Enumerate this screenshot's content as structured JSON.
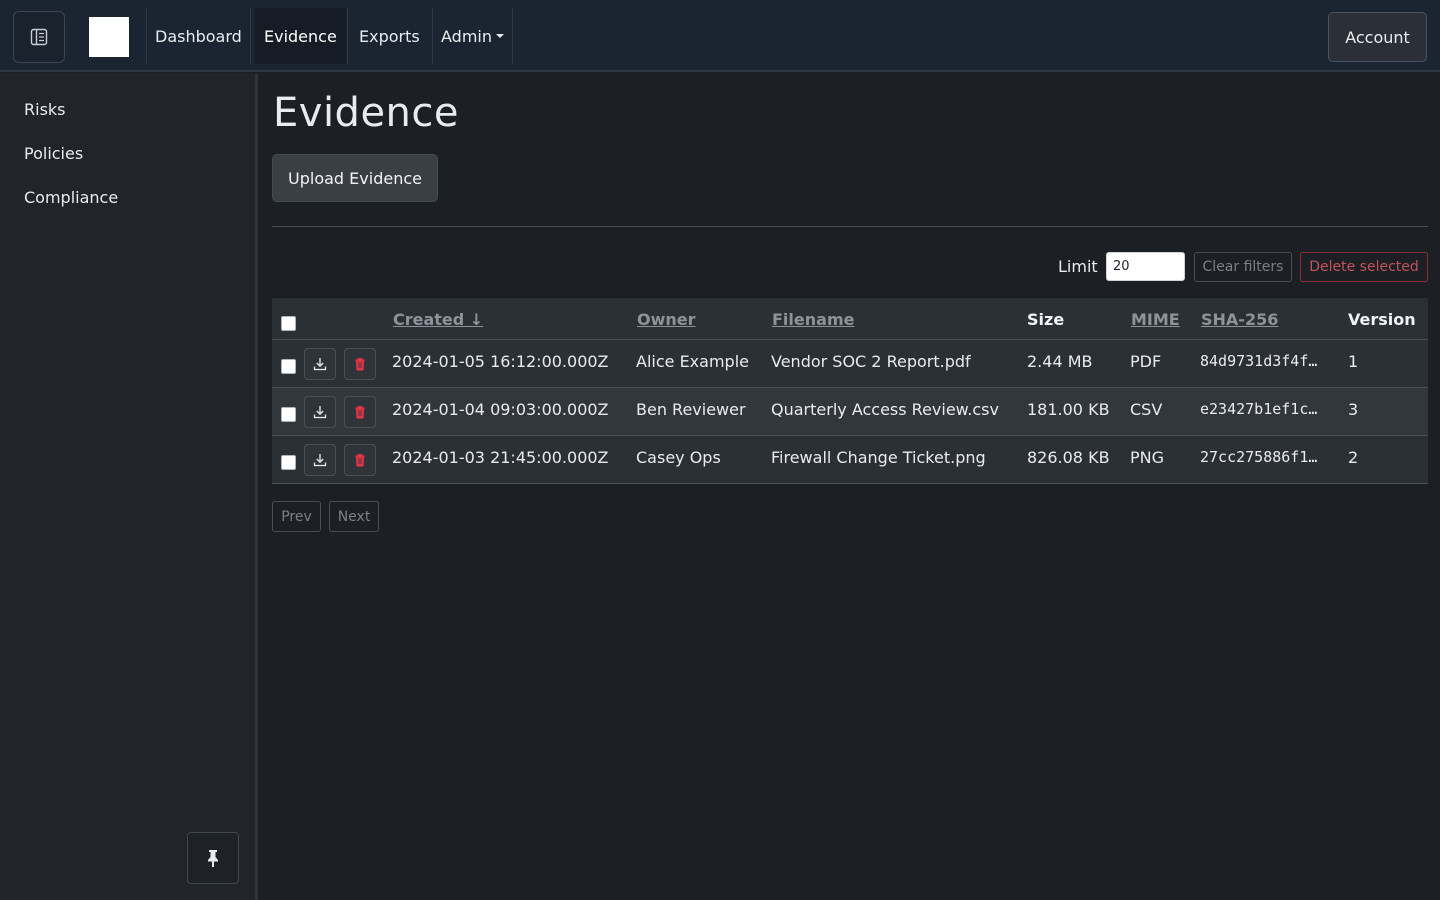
{
  "topbar": {
    "nav": [
      {
        "label": "Dashboard"
      },
      {
        "label": "Evidence"
      },
      {
        "label": "Exports"
      },
      {
        "label": "Admin"
      }
    ],
    "account_label": "Account"
  },
  "sidebar": {
    "items": [
      {
        "label": "Risks"
      },
      {
        "label": "Policies"
      },
      {
        "label": "Compliance"
      }
    ]
  },
  "main": {
    "title": "Evidence",
    "upload_label": "Upload Evidence",
    "limit_label": "Limit",
    "limit_value": "20",
    "clear_filters_label": "Clear filters",
    "delete_selected_label": "Delete selected",
    "prev_label": "Prev",
    "next_label": "Next"
  },
  "table": {
    "columns": [
      "Created ↓",
      "Owner",
      "Filename",
      "Size",
      "MIME",
      "SHA-256",
      "Version"
    ],
    "rows": [
      {
        "created": "2024-01-05 16:12:00.000Z",
        "owner": "Alice Example",
        "filename": "Vendor SOC 2 Report.pdf",
        "size": "2.44 MB",
        "mime": "PDF",
        "sha": "84d9731d3f4f…",
        "version": "1"
      },
      {
        "created": "2024-01-04 09:03:00.000Z",
        "owner": "Ben Reviewer",
        "filename": "Quarterly Access Review.csv",
        "size": "181.00 KB",
        "mime": "CSV",
        "sha": "e23427b1ef1c…",
        "version": "3"
      },
      {
        "created": "2024-01-03 21:45:00.000Z",
        "owner": "Casey Ops",
        "filename": "Firewall Change Ticket.png",
        "size": "826.08 KB",
        "mime": "PNG",
        "sha": "27cc275886f1…",
        "version": "2"
      }
    ]
  },
  "colors": {
    "background": "#1c1f23",
    "topbar": "#1b2532",
    "sidebar": "#212529",
    "danger": "#dc3545"
  },
  "icons": [
    "sidebar-toggle-icon",
    "download-icon",
    "trash-icon",
    "pin-icon"
  ]
}
